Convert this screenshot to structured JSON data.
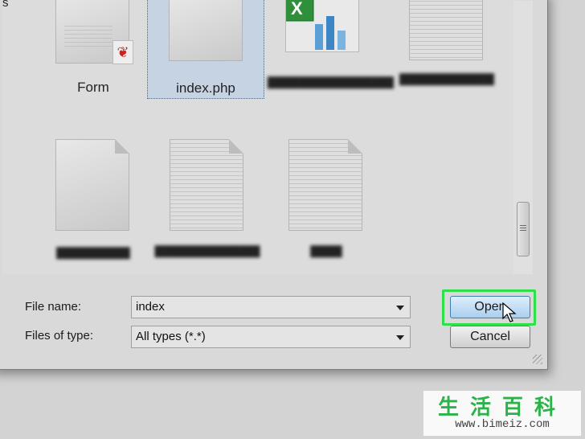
{
  "files_left_cut": "s",
  "tiles": [
    {
      "caption": "Form"
    },
    {
      "caption": "index.php"
    }
  ],
  "bottom": {
    "file_name_label": "File name:",
    "file_name_value": "index",
    "files_of_type_label": "Files of type:",
    "files_of_type_value": "All types (*.*)"
  },
  "buttons": {
    "open": "Open",
    "cancel": "Cancel"
  },
  "watermark": {
    "chinese": "生活百科",
    "url": "www.bimeiz.com"
  },
  "colors": {
    "highlight": "#2ee14a",
    "selection": "#c6d3e3"
  }
}
